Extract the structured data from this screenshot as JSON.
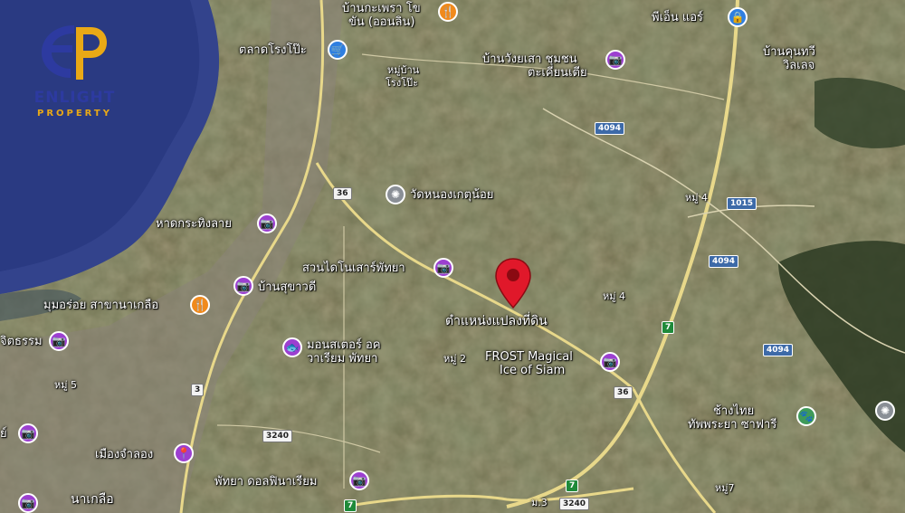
{
  "logo": {
    "brand": "ENLIGHT",
    "sub": "PROPERTY"
  },
  "places": {
    "top_center": "บ้านกะเพรา โข",
    "top_center2": "ขัน (ออนลิน)",
    "market": "ตลาดโรงโป๊ะ",
    "moo_rongpo": "หมู่บ้าน",
    "moo_rongpo2": "โรงโป๊ะ",
    "ban_wang": "บ้านวังยเสา ชุมชน",
    "ban_wang2": "ตะเคียนเตีย",
    "pien": "พีเอ็น แอร์",
    "ban_khun": "บ้านคุนทวี",
    "ban_khun2": "วิลเลจ",
    "temple": "วัดหนองเกตุน้อย",
    "beach": "หาดกระทิงลาย",
    "garden": "สวนไดโนเสาร์พัทยา",
    "ban_suk": "บ้านสุขาวดี",
    "restaurant": "มุมอร่อย สาขานาเกลือ",
    "marker_label": "ตำแหน่งแปลงที่ดิน",
    "moo4_center": "หมู่ 4",
    "moo4_ne": "หมู่ 4",
    "frost": "FROST Magical",
    "frost2": "Ice of Siam",
    "moo2": "หมู่ 2",
    "monster": "มอนสเตอร์ อค",
    "monster2": "วาเรียม พัทยา",
    "jitham": "จิตธรรม",
    "moo5": "หมู่ 5",
    "mueang_jamlong": "เมืองจำลอง",
    "dolphin": "พัทยา ดอลฟินาเรียม",
    "naklua": "นาเกลือ",
    "chang": "ช้างไทย",
    "chang2": "ทัพพระยา ซาฟารี",
    "moo3": "ม.3",
    "moo7": "หมู่7",
    "left_edge": "ย์"
  },
  "shields": {
    "r4094a": "4094",
    "r4094b": "4094",
    "r4094c": "4094",
    "r1015": "1015",
    "r36a": "36",
    "r36b": "36",
    "r3a": "3",
    "r3240a": "3240",
    "r3240b": "3240",
    "r7a": "7",
    "r7b": "7",
    "r7c": "7"
  },
  "colors": {
    "marker": "#e0182a",
    "poi_purple": "#9c3fd0",
    "poi_orange": "#f08a1c",
    "poi_blue": "#2f7fe0",
    "poi_gray": "#8a8f96",
    "poi_green": "#3f9a5a",
    "sea": "#2a3a82"
  }
}
